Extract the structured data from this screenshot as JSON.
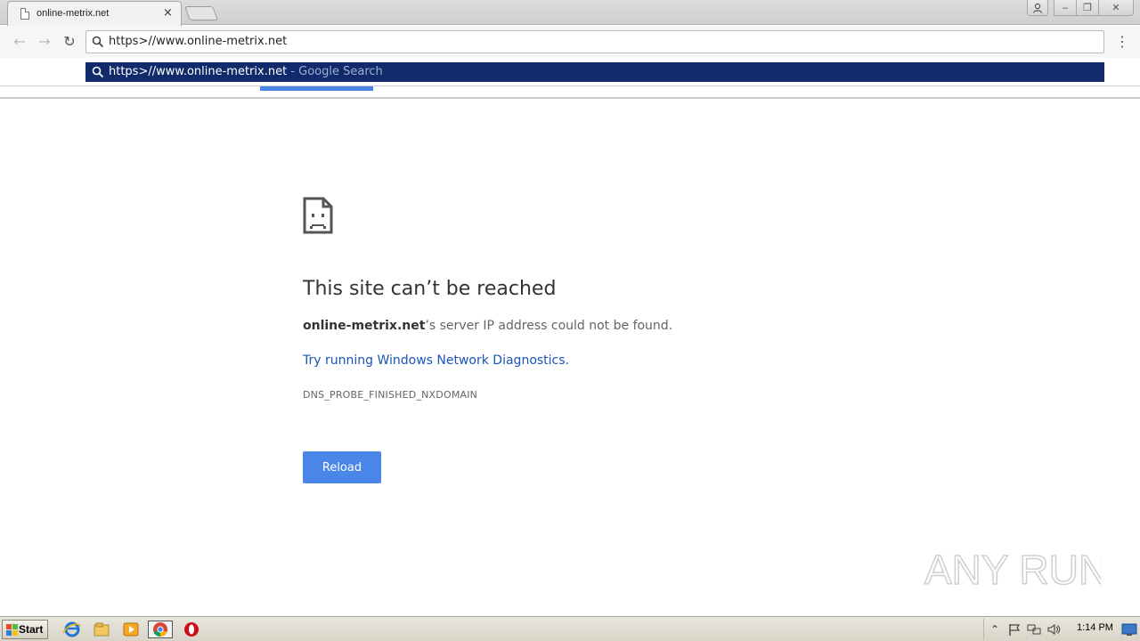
{
  "browser": {
    "tab": {
      "title": "online-metrix.net",
      "close_glyph": "×"
    },
    "window_controls": {
      "user_icon": "user-icon",
      "minimize": "‒",
      "maximize": "❐",
      "close": "✕"
    },
    "nav": {
      "back_glyph": "←",
      "forward_glyph": "→",
      "reload_glyph": "↻",
      "menu_glyph": "⋮"
    },
    "omnibox": {
      "value": "https>//www.online-metrix.net"
    },
    "suggestion": {
      "url": "https>//www.online-metrix.net",
      "suffix": " - Google Search"
    }
  },
  "error_page": {
    "title": "This site can’t be reached",
    "host": "online-metrix.net",
    "message": "’s server IP address could not be found.",
    "link": "Try running Windows Network Diagnostics.",
    "code": "DNS_PROBE_FINISHED_NXDOMAIN",
    "reload_label": "Reload"
  },
  "watermark": {
    "text": "ANY RUN"
  },
  "taskbar": {
    "start_label": "Start",
    "tray": {
      "expand_glyph": "⌃",
      "clock": "1:14 PM"
    }
  },
  "colors": {
    "accent": "#4a86e8",
    "suggestion_bg": "#102a6b",
    "link": "#1a55b7"
  }
}
